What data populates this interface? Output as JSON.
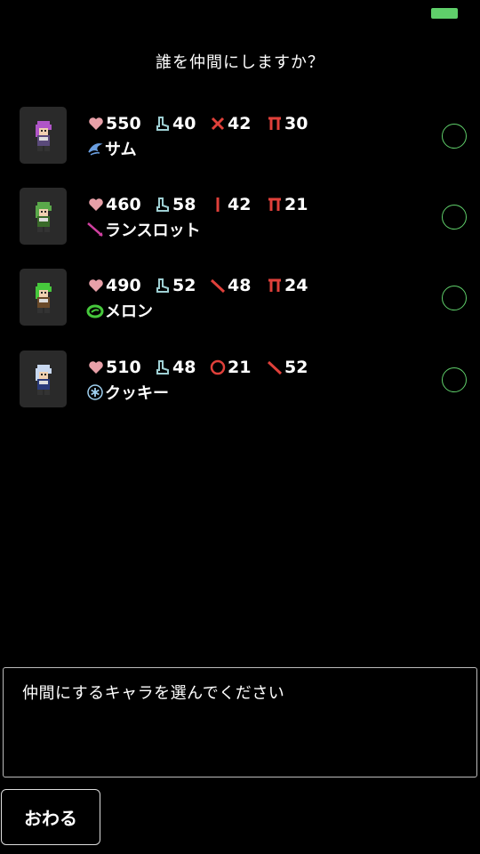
{
  "title": "誰を仲間にしますか？",
  "colors": {
    "accent": "#5fcf6a",
    "heart": "#e8a0a8",
    "boot": "#9fd0d4",
    "weapon": "#e0403a"
  },
  "characters": [
    {
      "name": "サム",
      "hp": "550",
      "speed": "40",
      "atk_type": "cross-icon",
      "atk": "42",
      "def_type": "pi-icon",
      "def": "30",
      "element": "wind-icon",
      "hair": "#b055c8",
      "cloth": "#5a4a7a"
    },
    {
      "name": "ランスロット",
      "hp": "460",
      "speed": "58",
      "atk_type": "bar-icon",
      "atk": "42",
      "def_type": "pi-icon",
      "def": "21",
      "element": "lance-icon",
      "hair": "#5aa84a",
      "cloth": "#3a6a2a"
    },
    {
      "name": "メロン",
      "hp": "490",
      "speed": "52",
      "atk_type": "slash-icon",
      "atk": "48",
      "def_type": "pi-icon",
      "def": "24",
      "element": "melon-icon",
      "hair": "#46c83c",
      "cloth": "#6a4a2a"
    },
    {
      "name": "クッキー",
      "hp": "510",
      "speed": "48",
      "atk_type": "ring-icon",
      "atk": "21",
      "def_type": "slash-icon",
      "def": "52",
      "element": "snow-icon",
      "hair": "#c8d8f0",
      "cloth": "#2a3a7a"
    }
  ],
  "message": "仲間にするキャラを選んでください",
  "end_button": "おわる"
}
